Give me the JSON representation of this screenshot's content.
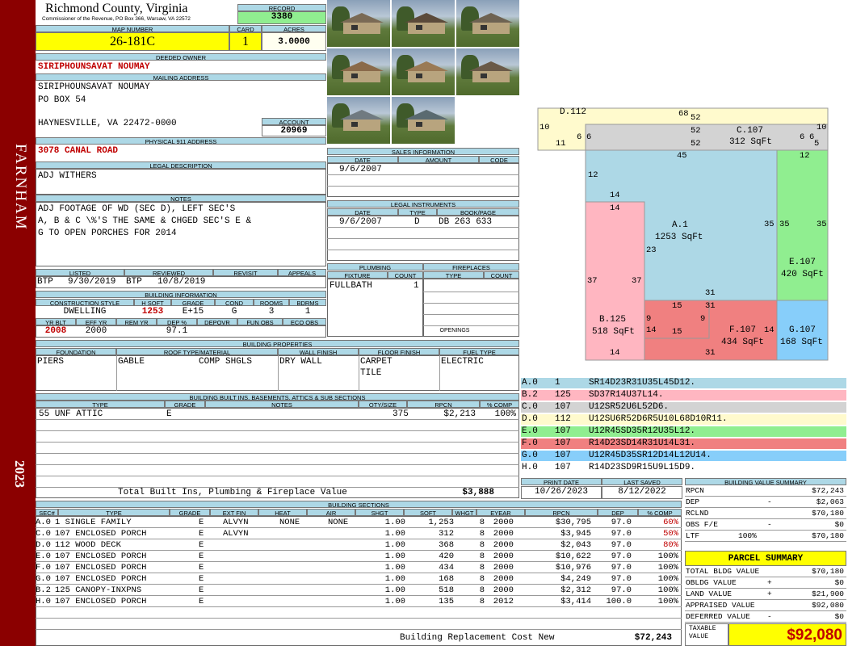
{
  "sidebar": {
    "district": "FARNHAM",
    "year": "2023"
  },
  "header": {
    "county": "Richmond County, Virginia",
    "commissioner": "Commissioner of the Revenue, PO Box 366, Warsaw, VA 22572",
    "record_label": "RECORD",
    "record": "3380",
    "map_label": "MAP NUMBER",
    "map": "26-181C",
    "card_label": "CARD",
    "card": "1",
    "acres_label": "ACRES",
    "acres": "3.0000"
  },
  "owner": {
    "deeded_label": "DEEDED OWNER",
    "deeded": "SIRIPHOUNSAVAT NOUMAY",
    "mailing_label": "MAILING ADDRESS",
    "line1": "SIRIPHOUNSAVAT NOUMAY",
    "line2": "PO BOX 54",
    "line3": "HAYNESVILLE, VA 22472-0000",
    "account_label": "ACCOUNT",
    "account": "20969",
    "physical_label": "PHYSICAL 911 ADDRESS",
    "physical": "3078 CANAL ROAD"
  },
  "legal": {
    "label": "LEGAL DESCRIPTION",
    "text": "ADJ WITHERS"
  },
  "notes": {
    "label": "NOTES",
    "line1": "ADJ FOOTAGE OF WD (SEC D), LEFT SEC'S",
    "line2": "A, B & C \\%'S THE SAME & CHGED SEC'S E &",
    "line3": "G TO OPEN PORCHES FOR 2014"
  },
  "review": {
    "listed_label": "LISTED",
    "listed_by": "BTP",
    "listed": "9/30/2019",
    "reviewed_label": "REVIEWED",
    "reviewed_by": "BTP",
    "reviewed": "10/8/2019",
    "revisit_label": "REVISIT",
    "appeals_label": "APPEALS"
  },
  "building_info": {
    "label": "BUILDING INFORMATION",
    "style_label": "CONSTRUCTION STYLE",
    "style": "DWELLING",
    "hsqft_label": "H SQFT",
    "hsqft": "1253",
    "grade_label": "GRADE",
    "grade": "E+15",
    "cond_label": "COND",
    "cond": "G",
    "rooms_label": "ROOMS",
    "rooms": "3",
    "bdrms_label": "BDRMS",
    "bdrms": "1",
    "yrblt_label": "YR BLT",
    "yrblt": "2008",
    "effyr_label": "EFF YR",
    "effyr": "2000",
    "remyr_label": "REM YR",
    "dep_label": "DEP %",
    "dep": "97.1",
    "depovr_label": "DEPOVR",
    "funobs_label": "FUN OBS",
    "ecoobs_label": "ECO OBS"
  },
  "sales": {
    "label": "SALES INFORMATION",
    "date_label": "DATE",
    "amount_label": "AMOUNT",
    "code_label": "CODE",
    "date": "9/6/2007"
  },
  "legal_inst": {
    "label": "LEGAL INSTRUMENTS",
    "date_label": "DATE",
    "type_label": "TYPE",
    "book_label": "BOOK/PAGE",
    "date": "9/6/2007",
    "type": "D",
    "book": "DB 263 633"
  },
  "plumbing": {
    "label": "PLUMBING",
    "fixture_label": "FIXTURE",
    "count_label": "COUNT",
    "fixture": "FULLBATH",
    "count": "1"
  },
  "fireplaces": {
    "label": "FIREPLACES",
    "type_label": "TYPE",
    "count_label": "COUNT",
    "openings_label": "OPENINGS"
  },
  "props": {
    "label": "BUILDING PROPERTIES",
    "foundation_label": "FOUNDATION",
    "roof_label": "ROOF TYPE/MATERIAL",
    "wall_label": "WALL FINISH",
    "floor_label": "FLOOR FINISH",
    "fuel_label": "FUEL TYPE",
    "foundation": "PIERS",
    "roof_type": "GABLE",
    "roof_mat": "COMP SHGLS",
    "wall": "DRY WALL",
    "floor1": "CARPET",
    "floor2": "TILE",
    "fuel": "ELECTRIC"
  },
  "builtins": {
    "label": "BUILDING BUILT INS, BASEMENTS, ATTICS & SUB SECTIONS",
    "type_label": "TYPE",
    "grade_label": "GRADE",
    "notes_label": "NOTES",
    "qty_label": "QTY/SIZE",
    "rpcn_label": "RPCN",
    "comp_label": "% COMP",
    "row_type": "55 UNF ATTIC",
    "row_grade": "E",
    "row_qty": "375",
    "row_rpcn": "$2,213",
    "row_comp": "100%",
    "total_label": "Total Built Ins, Plumbing & Fireplace Value",
    "total": "$3,888"
  },
  "dates": {
    "print_label": "PRINT DATE",
    "print": "10/26/2023",
    "saved_label": "LAST SAVED",
    "saved": "8/12/2022"
  },
  "sections": {
    "label": "BUILDING SECTIONS",
    "cols": [
      "SEC#",
      "TYPE",
      "GRADE",
      "EXT FIN",
      "HEAT",
      "AIR",
      "SHGT",
      "SQFT",
      "WHGT",
      "EYEAR",
      "RPCN",
      "DEP",
      "% COMP"
    ],
    "rows": [
      {
        "sec": "A.0",
        "type": "1 SINGLE FAMILY",
        "grade": "E",
        "ext": "ALVYN",
        "heat": "NONE",
        "air": "NONE",
        "shgt": "1.00",
        "sqft": "1,253",
        "whgt": "8",
        "eyear": "2000",
        "rpcn": "$30,795",
        "dep": "97.0",
        "comp": "60%",
        "red": true
      },
      {
        "sec": "C.0",
        "type": "107 ENCLOSED PORCH",
        "grade": "E",
        "ext": "ALVYN",
        "heat": "",
        "air": "",
        "shgt": "1.00",
        "sqft": "312",
        "whgt": "8",
        "eyear": "2000",
        "rpcn": "$3,945",
        "dep": "97.0",
        "comp": "50%",
        "red": true
      },
      {
        "sec": "D.0",
        "type": "112 WOOD DECK",
        "grade": "E",
        "ext": "",
        "heat": "",
        "air": "",
        "shgt": "1.00",
        "sqft": "368",
        "whgt": "8",
        "eyear": "2000",
        "rpcn": "$2,043",
        "dep": "97.0",
        "comp": "80%",
        "red": true
      },
      {
        "sec": "E.0",
        "type": "107 ENCLOSED PORCH",
        "grade": "E",
        "ext": "",
        "heat": "",
        "air": "",
        "shgt": "1.00",
        "sqft": "420",
        "whgt": "8",
        "eyear": "2000",
        "rpcn": "$10,622",
        "dep": "97.0",
        "comp": "100%",
        "red": false
      },
      {
        "sec": "F.0",
        "type": "107 ENCLOSED PORCH",
        "grade": "E",
        "ext": "",
        "heat": "",
        "air": "",
        "shgt": "1.00",
        "sqft": "434",
        "whgt": "8",
        "eyear": "2000",
        "rpcn": "$10,976",
        "dep": "97.0",
        "comp": "100%",
        "red": false
      },
      {
        "sec": "G.0",
        "type": "107 ENCLOSED PORCH",
        "grade": "E",
        "ext": "",
        "heat": "",
        "air": "",
        "shgt": "1.00",
        "sqft": "168",
        "whgt": "8",
        "eyear": "2000",
        "rpcn": "$4,249",
        "dep": "97.0",
        "comp": "100%",
        "red": false
      },
      {
        "sec": "B.2",
        "type": "125 CANOPY-INXPNS",
        "grade": "E",
        "ext": "",
        "heat": "",
        "air": "",
        "shgt": "1.00",
        "sqft": "518",
        "whgt": "8",
        "eyear": "2000",
        "rpcn": "$2,312",
        "dep": "97.0",
        "comp": "100%",
        "red": false
      },
      {
        "sec": "H.0",
        "type": "107 ENCLOSED PORCH",
        "grade": "E",
        "ext": "",
        "heat": "",
        "air": "",
        "shgt": "1.00",
        "sqft": "135",
        "whgt": "8",
        "eyear": "2012",
        "rpcn": "$3,414",
        "dep": "100.0",
        "comp": "100%",
        "red": false
      }
    ],
    "brcn_label": "Building Replacement Cost New",
    "brcn": "$72,243"
  },
  "sketch": {
    "labels": [
      {
        "id": "d-label",
        "text": "D.112"
      },
      {
        "id": "c-label",
        "text": "C.107"
      },
      {
        "id": "c-sqft",
        "text": "312 SqFt"
      },
      {
        "id": "a-label",
        "text": "A.1"
      },
      {
        "id": "a-sqft",
        "text": "1253 SqFt"
      },
      {
        "id": "e-label",
        "text": "E.107"
      },
      {
        "id": "e-sqft",
        "text": "420 SqFt"
      },
      {
        "id": "b-label",
        "text": "B.125"
      },
      {
        "id": "b-sqft",
        "text": "518 SqFt"
      },
      {
        "id": "f-label",
        "text": "F.107"
      },
      {
        "id": "f-sqft",
        "text": "434 SqFt"
      },
      {
        "id": "g-label",
        "text": "G.107"
      },
      {
        "id": "g-sqft",
        "text": "168 SqFt"
      }
    ],
    "dims": [
      "68",
      "52",
      "10",
      "10",
      "11",
      "6",
      "6",
      "6",
      "6",
      "5",
      "52",
      "52",
      "45",
      "12",
      "12",
      "14",
      "14",
      "35",
      "35",
      "35",
      "23",
      "37",
      "37",
      "31",
      "15",
      "31",
      "9",
      "9",
      "14",
      "15",
      "14",
      "14",
      "31"
    ]
  },
  "legend": [
    {
      "sec": "A.0",
      "code": "1",
      "path": "SR14D23R31U35L45D12.",
      "color": "#add8e6"
    },
    {
      "sec": "B.2",
      "code": "125",
      "path": "SD37R14U37L14.",
      "color": "#ffb6c1"
    },
    {
      "sec": "C.0",
      "code": "107",
      "path": "U12SR52U6L52D6.",
      "color": "#d3d3d3"
    },
    {
      "sec": "D.0",
      "code": "112",
      "path": "U12SU6R52D6R5U10L68D10R11.",
      "color": "#fffacd"
    },
    {
      "sec": "E.0",
      "code": "107",
      "path": "U12R45SD35R12U35L12.",
      "color": "#90ee90"
    },
    {
      "sec": "F.0",
      "code": "107",
      "path": "R14D23SD14R31U14L31.",
      "color": "#f08080"
    },
    {
      "sec": "G.0",
      "code": "107",
      "path": "U12R45D35SR12D14L12U14.",
      "color": "#87cefa"
    },
    {
      "sec": "H.0",
      "code": "107",
      "path": "R14D23SD9R15U9L15D9.",
      "color": "#ffffff"
    }
  ],
  "value_summary": {
    "label": "BUILDING VALUE SUMMARY",
    "rpcn_label": "RPCN",
    "rpcn": "$72,243",
    "dep_label": "DEP",
    "dep_sign": "-",
    "dep": "$2,063",
    "rclnd_label": "RCLND",
    "rclnd": "$70,180",
    "obs_label": "OBS F/E",
    "obs_sign": "-",
    "obs": "$0",
    "ltf_label": "LTF",
    "ltf_pct": "100%",
    "ltf": "$70,180"
  },
  "parcel": {
    "label": "PARCEL SUMMARY",
    "bldg_label": "TOTAL BLDG VALUE",
    "bldg": "$70,180",
    "obldg_label": "OBLDG VALUE",
    "obldg_sign": "+",
    "obldg": "$0",
    "land_label": "LAND VALUE",
    "land_sign": "+",
    "land": "$21,900",
    "appraised_label": "APPRAISED VALUE",
    "appraised": "$92,080",
    "deferred_label": "DEFERRED VALUE",
    "deferred_sign": "-",
    "deferred": "$0",
    "taxable_label1": "TAXABLE",
    "taxable_label2": "VALUE",
    "taxable": "$92,080"
  }
}
